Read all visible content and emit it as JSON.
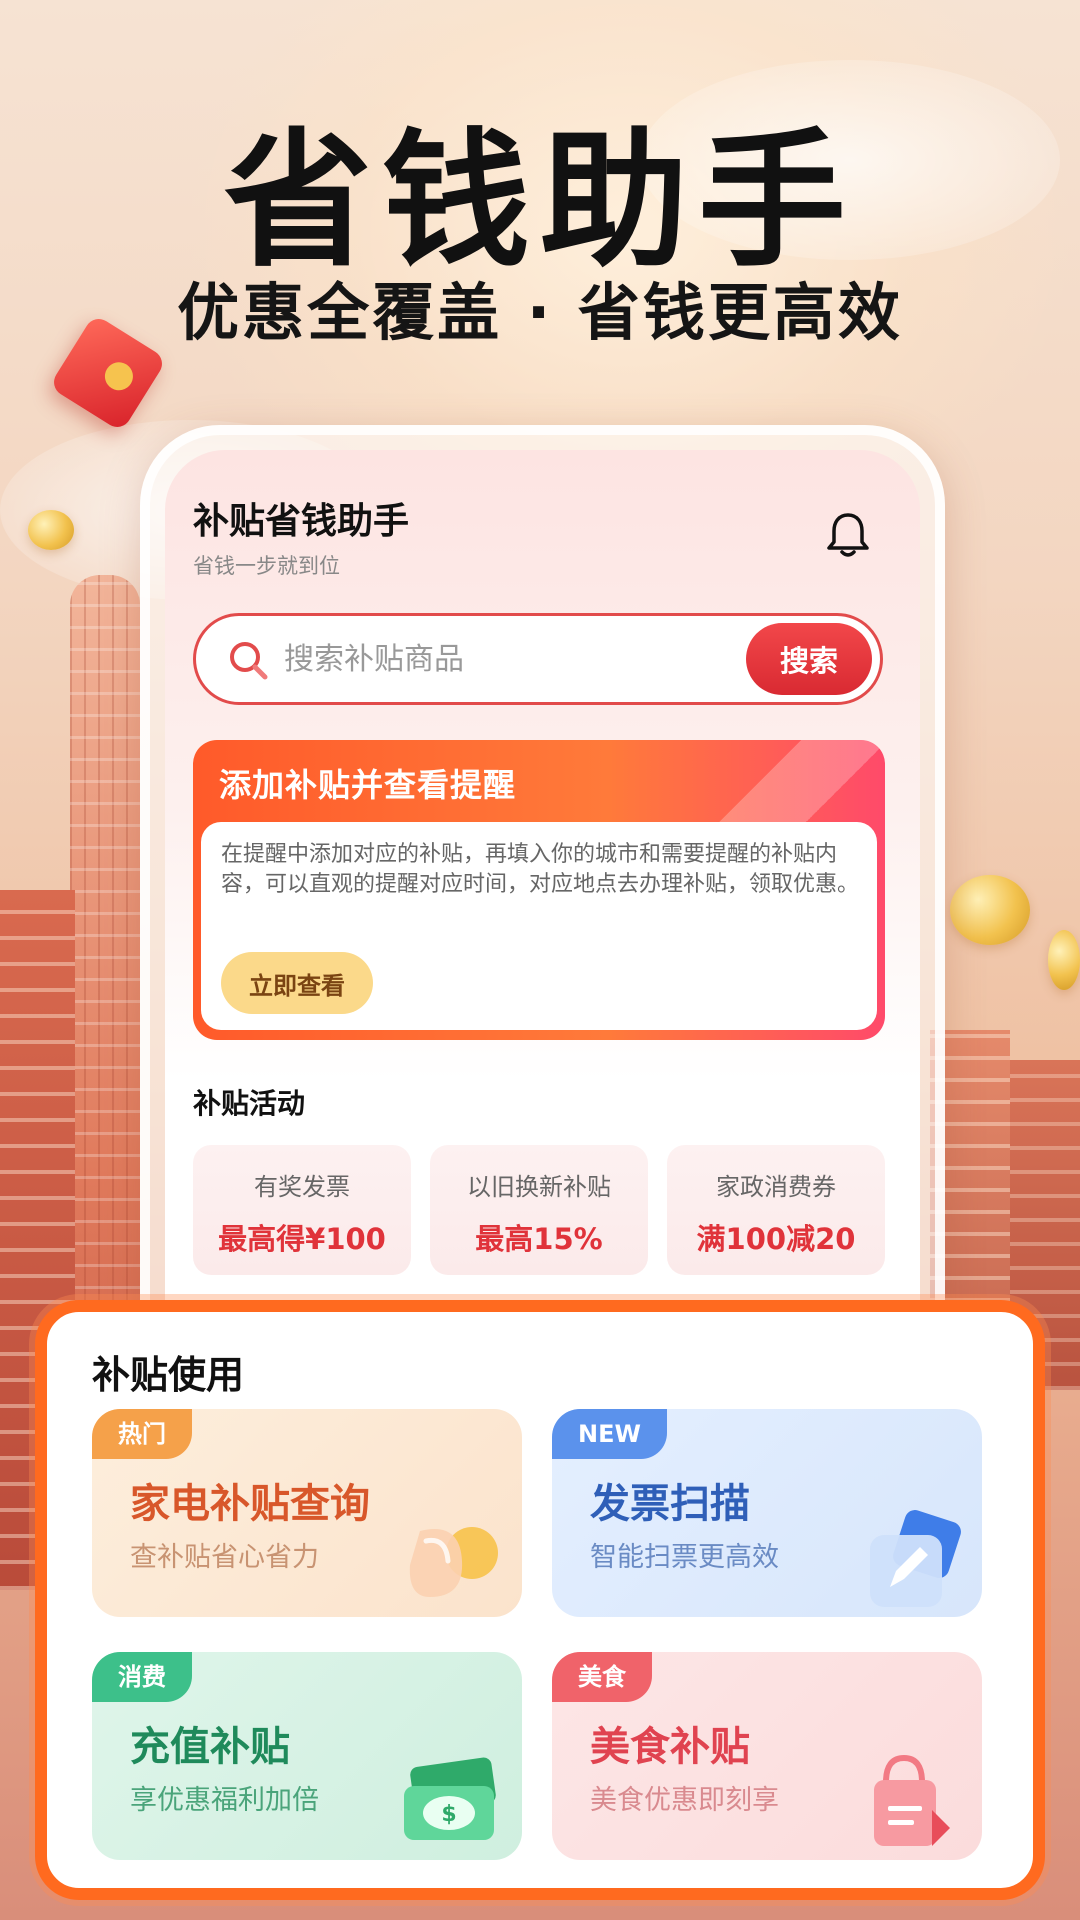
{
  "hero": {
    "headline": "省钱助手",
    "subheadline": "优惠全覆盖 · 省钱更高效"
  },
  "app": {
    "title": "补贴省钱助手",
    "subtitle": "省钱一步就到位",
    "search": {
      "placeholder": "搜索补贴商品",
      "button_label": "搜索"
    },
    "promo": {
      "title": "添加补贴并查看提醒",
      "description": "在提醒中添加对应的补贴，再填入你的城市和需要提醒的补贴内容，可以直观的提醒对应时间，对应地点去办理补贴，领取优惠。",
      "button_label": "立即查看"
    },
    "activities": {
      "section_title": "补贴活动",
      "items": [
        {
          "label": "有奖发票",
          "value": "最高得¥100"
        },
        {
          "label": "以旧换新补贴",
          "value": "最高15%"
        },
        {
          "label": "家政消费券",
          "value": "满100减20"
        }
      ]
    }
  },
  "usage": {
    "section_title": "补贴使用",
    "tiles": [
      {
        "badge": "热门",
        "title": "家电补贴查询",
        "subtitle": "查补贴省心省力",
        "icon": "appliance-icon"
      },
      {
        "badge": "NEW",
        "title": "发票扫描",
        "subtitle": "智能扫票更高效",
        "icon": "pen-edit-icon"
      },
      {
        "badge": "消费",
        "title": "充值补贴",
        "subtitle": "享优惠福利加倍",
        "icon": "cash-icon"
      },
      {
        "badge": "美食",
        "title": "美食补贴",
        "subtitle": "美食优惠即刻享",
        "icon": "shopping-bag-icon"
      }
    ]
  },
  "colors": {
    "accent_red": "#e0333a",
    "usage_border": "#ff6a1f"
  }
}
